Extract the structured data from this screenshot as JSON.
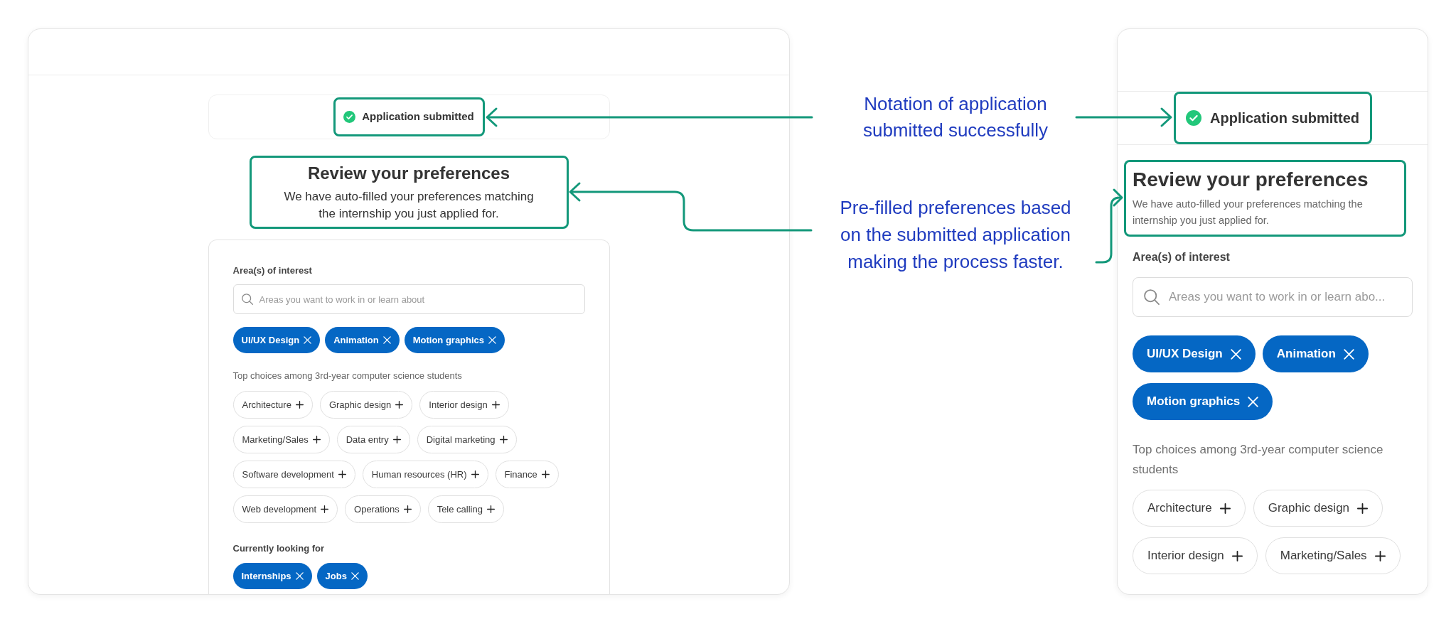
{
  "desktop_view": {
    "status": {
      "label": "Application submitted",
      "highlighted": true
    },
    "heading": {
      "title": "Review your preferences",
      "subtitle": "We have auto-filled your preferences matching the internship you just applied for.",
      "highlighted": true
    },
    "form": {
      "areas_label": "Area(s) of interest",
      "search": {
        "placeholder": "Areas you want to work in or learn about"
      },
      "selected_areas": [
        {
          "label": "UI/UX Design",
          "selected": true
        },
        {
          "label": "Animation",
          "selected": true
        },
        {
          "label": "Motion graphics",
          "selected": true
        }
      ],
      "suggestions_label": "Top choices among 3rd-year computer science students",
      "suggestions": [
        {
          "label": "Architecture",
          "selected": false
        },
        {
          "label": "Graphic design",
          "selected": false
        },
        {
          "label": "Interior design",
          "selected": false
        },
        {
          "label": "Marketing/Sales",
          "selected": false
        },
        {
          "label": "Data entry",
          "selected": false
        },
        {
          "label": "Digital marketing",
          "selected": false
        },
        {
          "label": "Software development",
          "selected": false
        },
        {
          "label": "Human resources (HR)",
          "selected": false
        },
        {
          "label": "Finance",
          "selected": false
        },
        {
          "label": "Web development",
          "selected": false
        },
        {
          "label": "Operations",
          "selected": false
        },
        {
          "label": "Tele calling",
          "selected": false
        }
      ],
      "looking_for_label": "Currently looking for",
      "looking_for": [
        {
          "label": "Internships",
          "selected": true
        },
        {
          "label": "Jobs",
          "selected": true
        }
      ]
    }
  },
  "mobile_view": {
    "status": {
      "label": "Application submitted",
      "highlighted": true
    },
    "heading": {
      "title": "Review your preferences",
      "subtitle": "We have auto-filled your preferences matching the internship you just applied for.",
      "highlighted": true
    },
    "form": {
      "areas_label": "Area(s) of interest",
      "search": {
        "placeholder": "Areas you want to work in or learn abo..."
      },
      "selected_areas": [
        {
          "label": "UI/UX Design",
          "selected": true
        },
        {
          "label": "Animation",
          "selected": true
        },
        {
          "label": "Motion graphics",
          "selected": true
        }
      ],
      "suggestions_label": "Top choices among 3rd-year computer science students",
      "suggestions": [
        {
          "label": "Architecture",
          "selected": false
        },
        {
          "label": "Graphic design",
          "selected": false
        },
        {
          "label": "Interior design",
          "selected": false
        },
        {
          "label": "Marketing/Sales",
          "selected": false
        }
      ]
    }
  },
  "annotations": [
    {
      "lines": [
        "Notation of application",
        "submitted successfully"
      ]
    },
    {
      "lines": [
        "Pre-filled preferences based",
        "on the submitted application",
        "making the process faster."
      ]
    }
  ]
}
